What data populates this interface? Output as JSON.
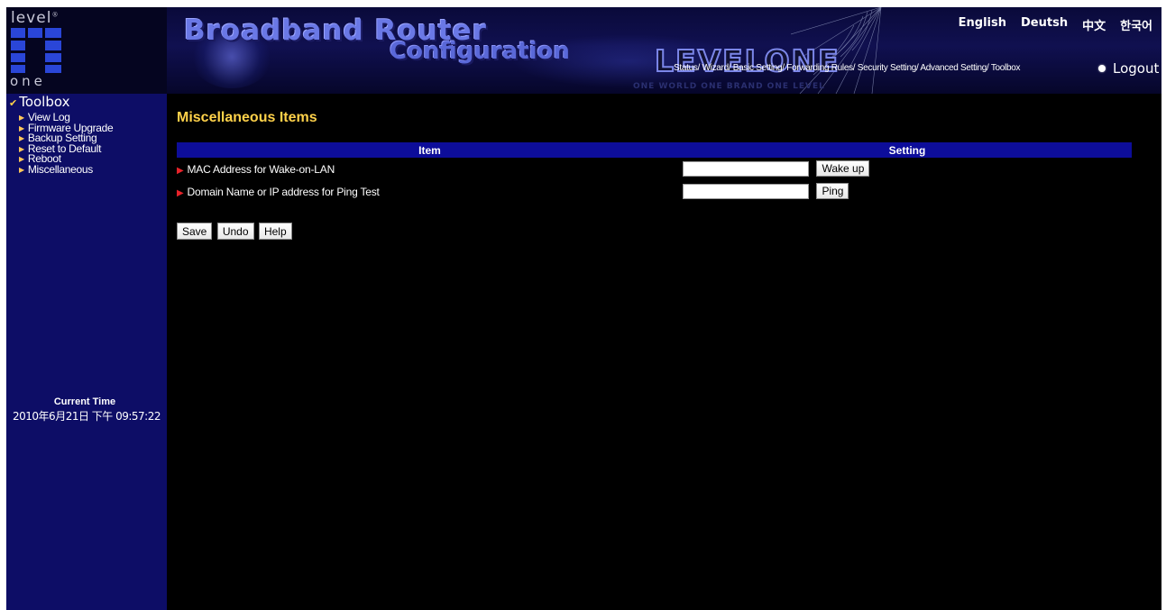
{
  "logo": {
    "top_text": "level",
    "trademark": "®",
    "bottom_text": "one"
  },
  "banner": {
    "title": "Broadband Router",
    "subtitle": "Configuration",
    "brand": "LEVELONE",
    "slogan": "ONE WORLD ONE BRAND ONE LEVEL"
  },
  "languages": [
    "English",
    "Deutsh",
    "中文",
    "한국어"
  ],
  "topnav": [
    "Status/",
    "Wizard/",
    "Basic Setting/",
    "Forwarding Rules/",
    "Security Setting/",
    "Advanced Setting/",
    "Toolbox"
  ],
  "logout_label": "Logout",
  "sidebar": {
    "title": "Toolbox",
    "items": [
      {
        "label": "View Log"
      },
      {
        "label": "Firmware Upgrade"
      },
      {
        "label": "Backup Setting"
      },
      {
        "label": "Reset to Default"
      },
      {
        "label": "Reboot"
      },
      {
        "label": "Miscellaneous"
      }
    ],
    "clock_label": "Current Time",
    "clock_value": "2010年6月21日 下午 09:57:22"
  },
  "main": {
    "title": "Miscellaneous Items",
    "table": {
      "headers": [
        "Item",
        "Setting"
      ],
      "rows": [
        {
          "label": "MAC Address for Wake-on-LAN",
          "input_value": "",
          "button": "Wake up"
        },
        {
          "label": "Domain Name or IP address for Ping Test",
          "input_value": "",
          "button": "Ping"
        }
      ]
    },
    "actions": {
      "save": "Save",
      "undo": "Undo",
      "help": "Help"
    }
  },
  "colors": {
    "page_background": "#000000",
    "sidebar_background": "#0d0d66",
    "table_header": "#0d0d9a",
    "title_yellow": "#ffd24a",
    "row_marker": "#e8232a"
  }
}
